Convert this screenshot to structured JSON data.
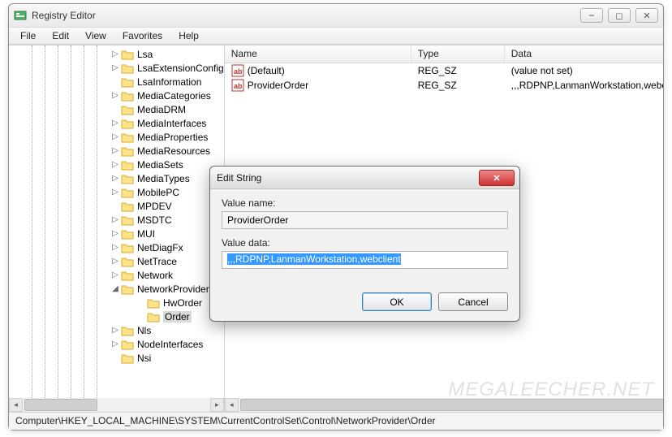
{
  "window": {
    "title": "Registry Editor"
  },
  "menu": {
    "file": "File",
    "edit": "Edit",
    "view": "View",
    "favorites": "Favorites",
    "help": "Help"
  },
  "tree": {
    "items": [
      {
        "label": "Lsa",
        "exp": "▷"
      },
      {
        "label": "LsaExtensionConfig",
        "exp": "▷"
      },
      {
        "label": "LsaInformation",
        "exp": ""
      },
      {
        "label": "MediaCategories",
        "exp": "▷"
      },
      {
        "label": "MediaDRM",
        "exp": ""
      },
      {
        "label": "MediaInterfaces",
        "exp": "▷"
      },
      {
        "label": "MediaProperties",
        "exp": "▷"
      },
      {
        "label": "MediaResources",
        "exp": "▷"
      },
      {
        "label": "MediaSets",
        "exp": "▷"
      },
      {
        "label": "MediaTypes",
        "exp": "▷"
      },
      {
        "label": "MobilePC",
        "exp": "▷"
      },
      {
        "label": "MPDEV",
        "exp": ""
      },
      {
        "label": "MSDTC",
        "exp": "▷"
      },
      {
        "label": "MUI",
        "exp": "▷"
      },
      {
        "label": "NetDiagFx",
        "exp": "▷"
      },
      {
        "label": "NetTrace",
        "exp": "▷"
      },
      {
        "label": "Network",
        "exp": "▷"
      },
      {
        "label": "NetworkProvider",
        "exp": "◢"
      },
      {
        "label": "Nls",
        "exp": "▷"
      },
      {
        "label": "NodeInterfaces",
        "exp": "▷"
      },
      {
        "label": "Nsi",
        "exp": ""
      }
    ],
    "children": [
      {
        "label": "HwOrder"
      },
      {
        "label": "Order"
      }
    ],
    "selected_index": 1
  },
  "list": {
    "headers": {
      "name": "Name",
      "type": "Type",
      "data": "Data"
    },
    "rows": [
      {
        "name": "(Default)",
        "type": "REG_SZ",
        "data": "(value not set)"
      },
      {
        "name": "ProviderOrder",
        "type": "REG_SZ",
        "data": ",,,RDPNP,LanmanWorkstation,webclient"
      }
    ]
  },
  "statusbar": "Computer\\HKEY_LOCAL_MACHINE\\SYSTEM\\CurrentControlSet\\Control\\NetworkProvider\\Order",
  "dialog": {
    "title": "Edit String",
    "value_name_label": "Value name:",
    "value_name": "ProviderOrder",
    "value_data_label": "Value data:",
    "value_data": ",,,RDPNP,LanmanWorkstation,webclient",
    "ok": "OK",
    "cancel": "Cancel"
  },
  "watermark": "MEGALEECHER.NET"
}
